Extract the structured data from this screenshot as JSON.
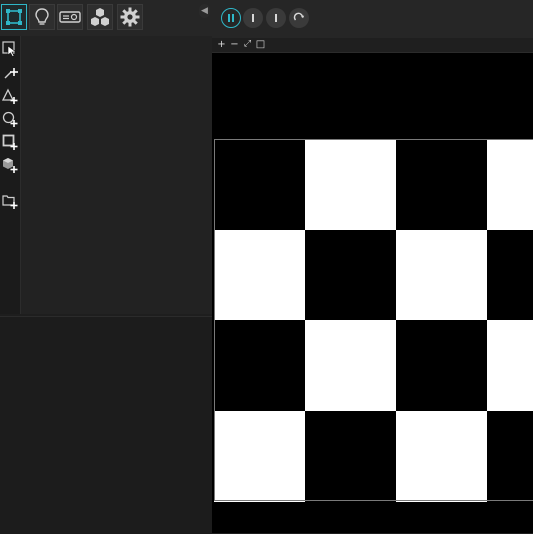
{
  "toolbar": {
    "tools": [
      {
        "icon": "transform-icon",
        "active": true
      },
      {
        "icon": "lightbulb-icon",
        "active": false
      },
      {
        "icon": "projector-icon",
        "active": false
      },
      {
        "icon": "cubes-icon",
        "active": false
      },
      {
        "icon": "gear-icon",
        "active": false
      }
    ],
    "collapse_icon": "chevron-left-icon"
  },
  "side_tools": [
    "select-arrow-icon",
    "add-point-icon",
    "add-triangle-icon",
    "add-circle-icon",
    "add-rectangle-icon",
    "add-cube-icon",
    "add-layer-icon"
  ],
  "playback": {
    "buttons": [
      "pause-icon",
      "step-icon",
      "step-icon",
      "loop-icon"
    ],
    "accent": "#2fb7c8"
  },
  "zoom": {
    "plus": "+",
    "minus": "−",
    "fit": "⤢",
    "frame": "□"
  },
  "viewport": {
    "pattern": "checkerboard",
    "rows": 4,
    "cols": 4,
    "colors": [
      "#000000",
      "#ffffff"
    ]
  }
}
